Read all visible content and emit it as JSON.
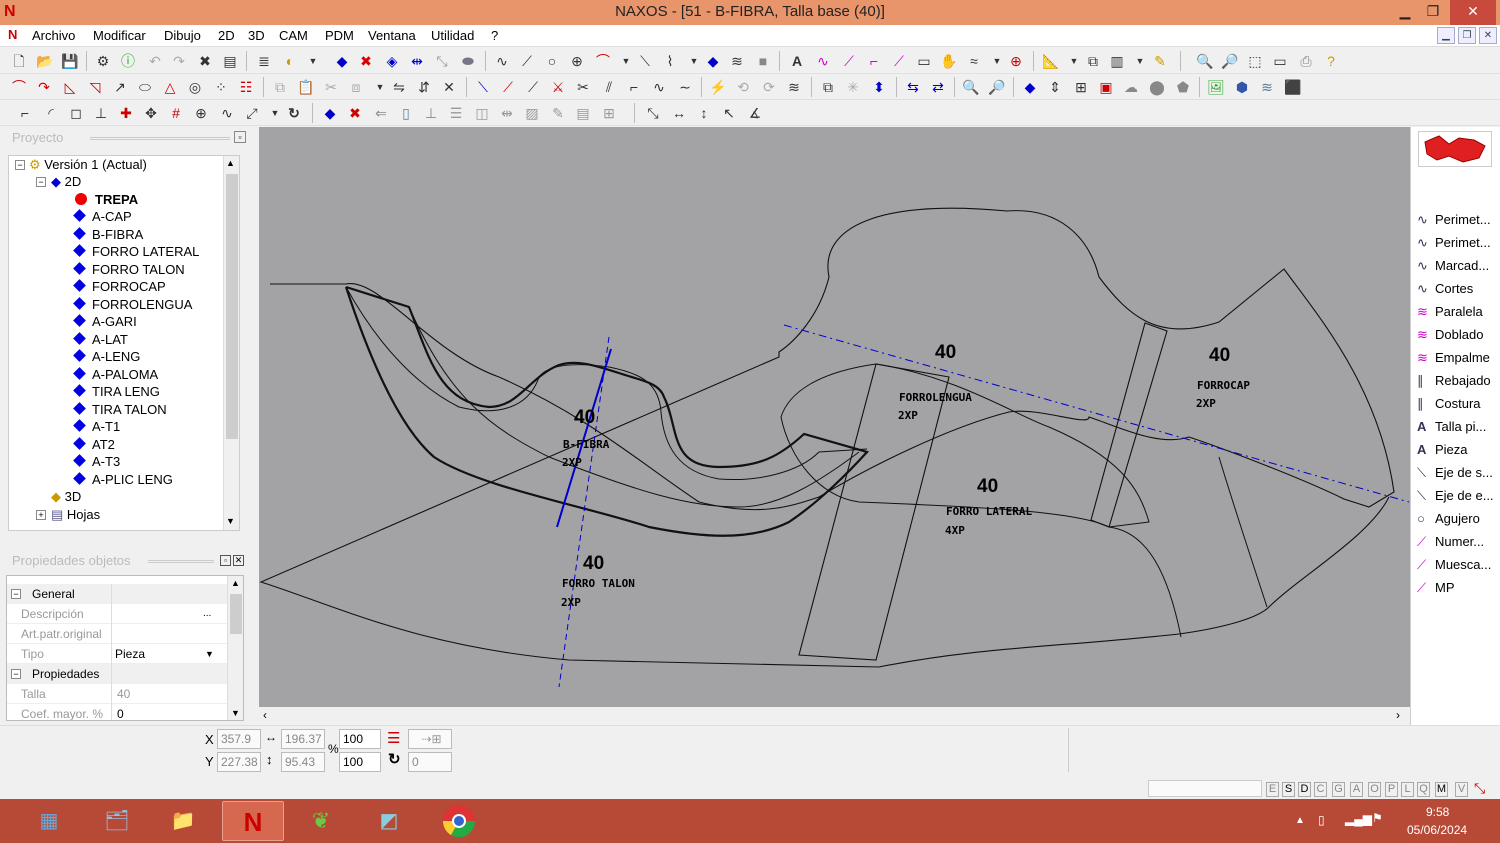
{
  "window": {
    "title": "NAXOS - [51 - B-FIBRA, Talla base (40)]",
    "logo_letter": "N",
    "btn_min": "▁",
    "btn_max": "❐",
    "btn_close": "✕"
  },
  "menu": {
    "items": [
      "Archivo",
      "Modificar",
      "Dibujo",
      "2D",
      "3D",
      "CAM",
      "PDM",
      "Ventana",
      "Utilidad",
      "?"
    ]
  },
  "project_panel": {
    "title": "Proyecto",
    "root": "Versión 1 (Actual)",
    "node_2d": "2D",
    "items": [
      "TREPA",
      "A-CAP",
      "B-FIBRA",
      "FORRO LATERAL",
      "FORRO TALON",
      "FORROCAP",
      "FORROLENGUA",
      "A-GARI",
      "A-LAT",
      "A-LENG",
      "A-PALOMA",
      "TIRA LENG",
      "TIRA TALON",
      "A-T1",
      "AT2",
      "A-T3",
      "A-PLIC LENG"
    ],
    "node_3d": "3D",
    "node_hojas": "Hojas"
  },
  "properties_panel": {
    "title": "Propiedades objetos",
    "group_general": "General",
    "descripcion_label": "Descripción",
    "descripcion_value": "",
    "art_label": "Art.patr.original",
    "tipo_label": "Tipo",
    "tipo_value": "Pieza",
    "group_props": "Propiedades",
    "talla_label": "Talla",
    "talla_value": "40",
    "coef_label": "Coef. mayor. %",
    "coef_value": "0"
  },
  "canvas": {
    "labels": [
      {
        "size": "40",
        "name": "B-FIBRA",
        "qty": "2XP"
      },
      {
        "size": "40",
        "name": "FORRO TALON",
        "qty": "2XP"
      },
      {
        "size": "40",
        "name": "FORROLENGUA",
        "qty": "2XP"
      },
      {
        "size": "40",
        "name": "FORRO LATERAL",
        "qty": "4XP"
      },
      {
        "size": "40",
        "name": "FORROCAP",
        "qty": "2XP"
      }
    ]
  },
  "right_tools": [
    "Perimet...",
    "Perimet...",
    "Marcad...",
    "Cortes",
    "Paralela",
    "Doblado",
    "Empalme",
    "Rebajado",
    "Costura",
    "Talla pi...",
    "Pieza",
    "Eje de s...",
    "Eje de e...",
    "Agujero",
    "Numer...",
    "Muesca...",
    "MP"
  ],
  "status": {
    "x_label": "X",
    "x_value": "357.9",
    "y_label": "Y",
    "y_value": "227.38",
    "w_value": "196.37",
    "h_value": "95.43",
    "pct_label": "%",
    "scale_x": "100",
    "scale_y": "100",
    "rot_value": "0"
  },
  "status_letters": [
    "E",
    "S",
    "D",
    "C",
    "G",
    "A",
    "O",
    "P",
    "L",
    "Q",
    "M",
    "V"
  ],
  "taskbar": {
    "time": "9:58",
    "date": "05/06/2024"
  },
  "colors": {
    "titlebar": "#e8956c",
    "canvas": "#a3a3a6",
    "taskbar": "#b74a36",
    "axis_blue": "#0000cc"
  }
}
